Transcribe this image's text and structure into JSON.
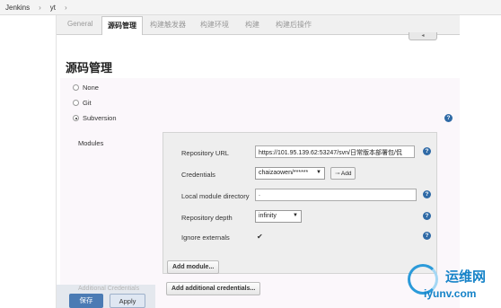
{
  "breadcrumb": {
    "items": [
      "Jenkins",
      "yt"
    ],
    "separator": "›"
  },
  "tabs": [
    "General",
    "源码管理",
    "构建触发器",
    "构建环境",
    "构建",
    "构建后操作"
  ],
  "active_tab": "源码管理",
  "section_title": "源码管理",
  "scm_options": [
    {
      "label": "None",
      "selected": false
    },
    {
      "label": "Git",
      "selected": false
    },
    {
      "label": "Subversion",
      "selected": true
    }
  ],
  "modules_label": "Modules",
  "fields": {
    "repository_url_label": "Repository URL",
    "repository_url_value": "https://101.95.139.62:53247/svn/日常版本部署包/侃",
    "credentials_label": "Credentials",
    "credentials_value": "chaizaowen/******",
    "add_button": "Add",
    "local_module_directory_label": "Local module directory",
    "local_module_directory_value": ".",
    "repository_depth_label": "Repository depth",
    "repository_depth_value": "infinity",
    "ignore_externals_label": "Ignore externals",
    "ignore_externals_checked": true
  },
  "buttons": {
    "add_module": "Add module...",
    "add_additional_credentials": "Add additional credentials...",
    "save": "保存",
    "apply": "Apply"
  },
  "ghost_label": "Additional Credentials",
  "help_glyph": "?",
  "watermark": {
    "brand": "运维网",
    "url": "iyunv.com"
  },
  "colors": {
    "help": "#2f6aa6",
    "save": "#4b7bb4",
    "watermark": "#1683c8"
  }
}
